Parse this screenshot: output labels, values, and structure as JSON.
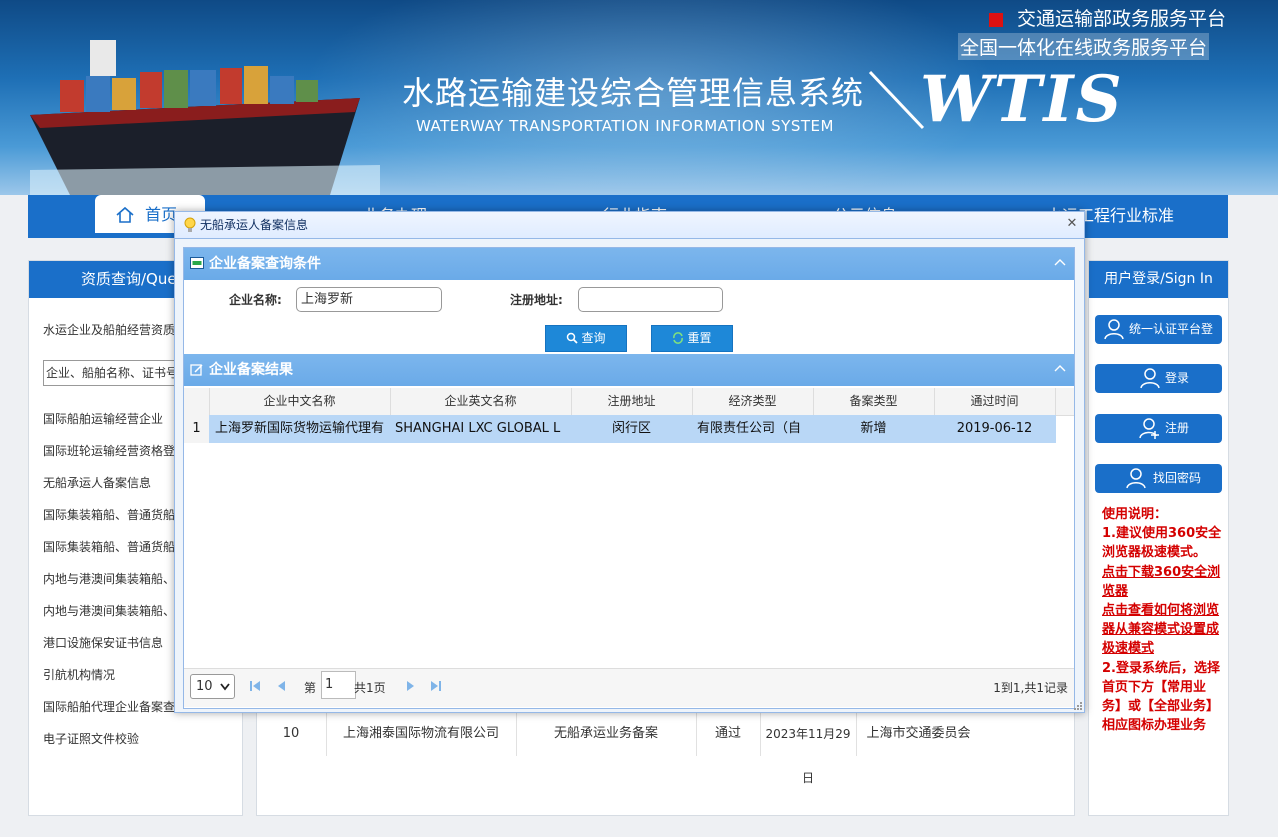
{
  "header": {
    "portal_line1": "交通运输部政务服务平台",
    "portal_line2": "全国一体化在线政务服务平台",
    "system_title": "水路运输建设综合管理信息系统",
    "system_subtitle": "WATERWAY TRANSPORTATION INFORMATION SYSTEM",
    "logo_text": "WTIS"
  },
  "nav": {
    "home": "首页",
    "items": [
      "业务办理",
      "行业指南",
      "公示信息",
      "水运工程行业标准"
    ]
  },
  "left_panel": {
    "title": "资质查询/Que",
    "desc": "水运企业及船舶经营资质",
    "select_value": "企业、船舶名称、证书号",
    "links": [
      "国际船舶运输经营企业",
      "国际班轮运输经营资格登",
      "无船承运人备案信息",
      "国际集装箱船、普通货船",
      "国际集装箱船、普通货船",
      "内地与港澳间集装箱船、",
      "内地与港澳间集装箱船、",
      "港口设施保安证书信息",
      "引航机构情况",
      "国际船舶代理企业备案查",
      "电子证照文件校验"
    ]
  },
  "background_row": {
    "no": "10",
    "company": "上海湘泰国际物流有限公司",
    "type": "无船承运业务备案",
    "status": "通过",
    "date": "2023年11月29日",
    "authority": "上海市交通委员会"
  },
  "right_panel": {
    "title": "用户登录/Sign In",
    "buttons": [
      "统一认证平台登录",
      "登录",
      "注册",
      "找回密码"
    ],
    "notes": {
      "heading": "使用说明：",
      "line1": "1.建议使用360安全浏览器极速模式。",
      "link1": "点击下载360安全浏览器",
      "link2": "点击查看如何将浏览器从兼容模式设置成极速模式",
      "line2": "2.登录系统后，选择首页下方【常用业务】或【全部业务】相应图标办理业务"
    }
  },
  "dialog": {
    "title": "无船承运人备案信息",
    "query_section": "企业备案查询条件",
    "name_label": "企业名称:",
    "name_value": "上海罗新",
    "address_label": "注册地址:",
    "address_value": "",
    "query_btn": "查询",
    "reset_btn": "重置",
    "result_section": "企业备案结果",
    "columns": [
      "企业中文名称",
      "企业英文名称",
      "注册地址",
      "经济类型",
      "备案类型",
      "通过时间"
    ],
    "rows": [
      {
        "no": "1",
        "cn_name": "上海罗新国际货物运输代理有",
        "en_name": "SHANGHAI LXC GLOBAL L",
        "address": "闵行区",
        "economy": "有限责任公司（自",
        "type": "新增",
        "date": "2019-06-12"
      }
    ],
    "pager": {
      "page_size": "10",
      "page_prefix": "第",
      "page_value": "1",
      "page_total": "共1页",
      "summary": "1到1,共1记录"
    }
  }
}
